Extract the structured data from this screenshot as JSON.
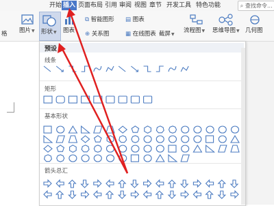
{
  "menu": {
    "tabs": [
      {
        "label": "开始"
      },
      {
        "label": "插入",
        "active": true
      },
      {
        "label": "页面布局"
      },
      {
        "label": "引用"
      },
      {
        "label": "审阅"
      },
      {
        "label": "视图"
      },
      {
        "label": "章节"
      },
      {
        "label": "开发工具"
      },
      {
        "label": "特色功能"
      }
    ],
    "search_placeholder": "查找命令..."
  },
  "ribbon": {
    "left_label": "格",
    "picture": "图片",
    "shape": "形状",
    "chart": "图表",
    "smart_art": "智能图形",
    "chart_small": "图表",
    "relation": "关系图",
    "online_chart": "在线图表",
    "screenshot": "截屏",
    "flowchart": "流程图",
    "mindmap": "思维导图",
    "geometry": "几何图"
  },
  "panel": {
    "header": "预设",
    "sections": [
      {
        "title": "线条"
      },
      {
        "title": "矩形"
      },
      {
        "title": "基本形状"
      },
      {
        "title": "箭头总汇"
      }
    ]
  },
  "colors": {
    "active_tab": "#4a78c8",
    "shape_stroke": "#4a7ac0",
    "arrow_red": "#e02020"
  }
}
